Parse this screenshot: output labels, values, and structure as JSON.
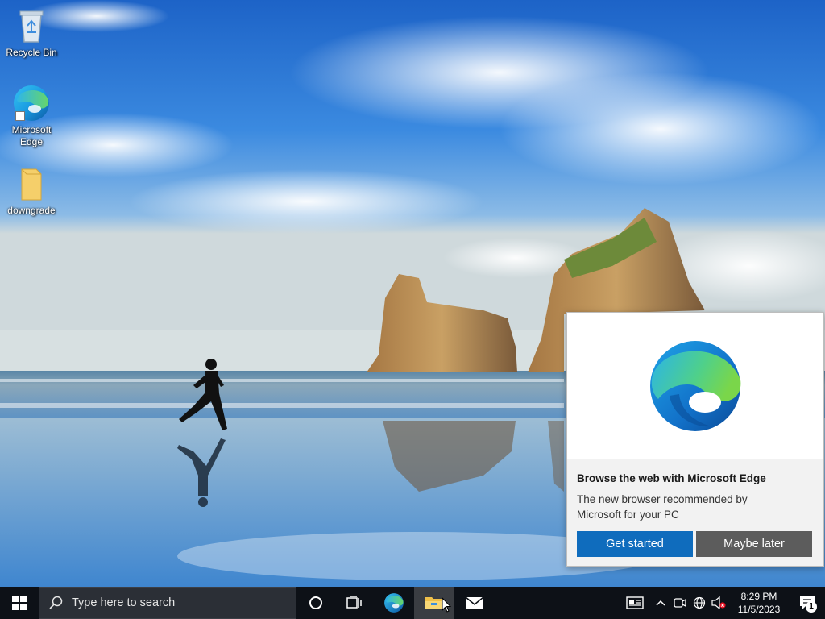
{
  "desktop": {
    "icons": [
      {
        "label": "Recycle Bin",
        "icon": "recycle-bin-icon"
      },
      {
        "label": "Microsoft Edge",
        "icon": "edge-icon"
      },
      {
        "label": "downgrade",
        "icon": "folder-icon"
      }
    ]
  },
  "edge_popup": {
    "title": "Browse the web with Microsoft Edge",
    "description": "The new browser recommended by Microsoft for your PC",
    "primary_button": "Get started",
    "secondary_button": "Maybe later"
  },
  "taskbar": {
    "search_placeholder": "Type here to search",
    "pinned": [
      "edge-icon",
      "file-explorer-icon",
      "mail-icon"
    ],
    "tray_icons": [
      "news-icon",
      "chevron-up-icon",
      "meet-now-icon",
      "network-icon",
      "volume-muted-icon"
    ],
    "clock_time": "8:29 PM",
    "clock_date": "11/5/2023",
    "notification_count": "1"
  },
  "colors": {
    "taskbar_bg": "#0d1117",
    "primary_button": "#0f6cbd",
    "secondary_button": "#5c5c5c"
  }
}
